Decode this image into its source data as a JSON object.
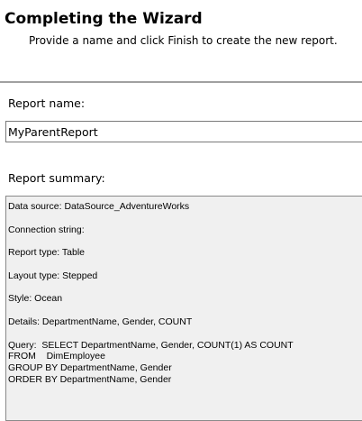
{
  "header": {
    "title": "Completing the Wizard",
    "subtitle": "Provide a name and click Finish to create the new report."
  },
  "report_name": {
    "label": "Report name:",
    "value": "MyParentReport"
  },
  "report_summary": {
    "label": "Report summary:",
    "text": "Data source: DataSource_AdventureWorks\n\nConnection string:\n\nReport type: Table\n\nLayout type: Stepped\n\nStyle: Ocean\n\nDetails: DepartmentName, Gender, COUNT\n\nQuery:  SELECT DepartmentName, Gender, COUNT(1) AS COUNT\nFROM    DimEmployee\nGROUP BY DepartmentName, Gender\nORDER BY DepartmentName, Gender"
  }
}
